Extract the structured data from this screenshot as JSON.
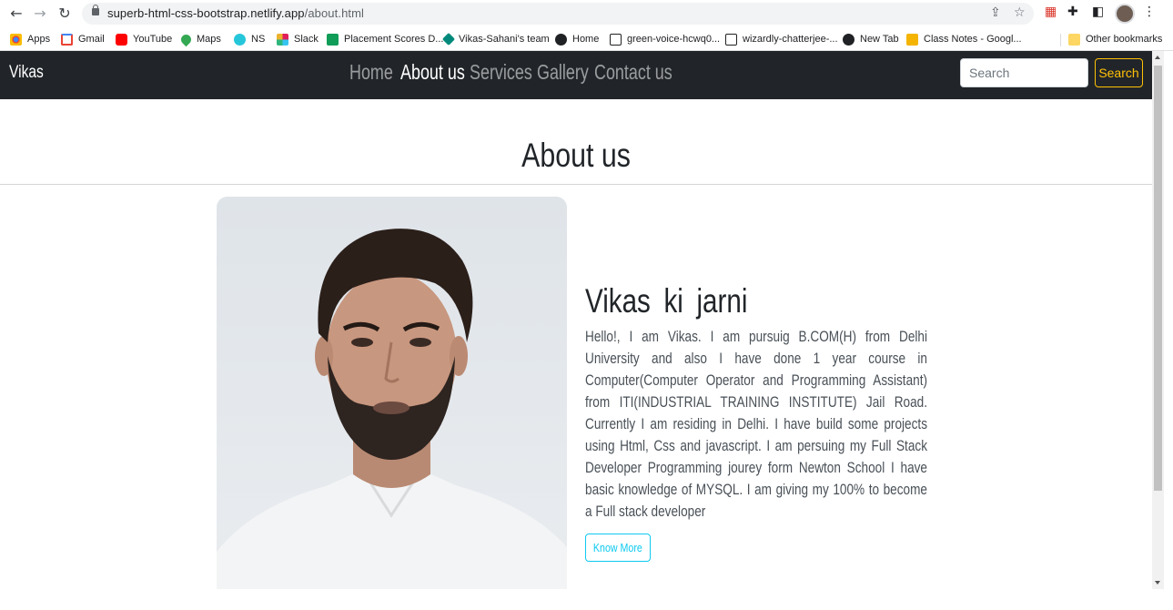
{
  "browser": {
    "url_host": "superb-html-css-bootstrap.netlify.app",
    "url_path": "/about.html",
    "bookmarks": [
      {
        "label": "Apps",
        "icon": "apps-grid-icon",
        "color": "#4285f4"
      },
      {
        "label": "Gmail",
        "icon": "gmail-icon",
        "color": "#ea4335"
      },
      {
        "label": "YouTube",
        "icon": "youtube-icon",
        "color": "#ff0000"
      },
      {
        "label": "Maps",
        "icon": "maps-pin-icon",
        "color": "#34a853"
      },
      {
        "label": "NS",
        "icon": "ns-icon",
        "color": "#26c6da"
      },
      {
        "label": "Slack",
        "icon": "slack-icon",
        "color": "#e01e5a"
      },
      {
        "label": "Placement Scores D...",
        "icon": "sheets-icon",
        "color": "#0f9d58"
      },
      {
        "label": "Vikas-Sahani's team",
        "icon": "team-diamond-icon",
        "color": "#00897b"
      },
      {
        "label": "Home",
        "icon": "globe-icon",
        "color": "#202124"
      },
      {
        "label": "green-voice-hcwq0...",
        "icon": "page-icon",
        "color": "#202124"
      },
      {
        "label": "wizardly-chatterjee-...",
        "icon": "page-icon",
        "color": "#202124"
      },
      {
        "label": "New Tab",
        "icon": "globe-icon",
        "color": "#202124"
      },
      {
        "label": "Class Notes - Googl...",
        "icon": "slides-icon",
        "color": "#f4b400"
      }
    ],
    "other_bookmarks": "Other bookmarks"
  },
  "navbar": {
    "brand": "Vikas",
    "links": [
      {
        "label": "Home",
        "active": false
      },
      {
        "label": "About us",
        "active": true
      },
      {
        "label": "Services",
        "active": false
      },
      {
        "label": "Gallery",
        "active": false
      },
      {
        "label": "Contact us",
        "active": false
      }
    ],
    "search_placeholder": "Search",
    "search_button": "Search"
  },
  "page": {
    "title": "About us",
    "heading": "Vikas ki jarni",
    "paragraph": "Hello!, I am Vikas. I am pursuig B.COM(H) from Delhi University and also I have done 1 year course in Computer(Computer Operator and Programming Assistant) from ITI(INDUSTRIAL TRAINING INSTITUTE) Jail Road. Currently I am residing in Delhi. I have build some projects using Html, Css and javascript. I am persuing my Full Stack Developer Programming jourey form Newton School I have basic knowledge of MYSQL. I am giving my 100% to become a Full stack developer",
    "button": "Know More"
  },
  "colors": {
    "navbar_bg": "#212529",
    "search_outline": "#ffc107",
    "know_more_outline": "#0dcaf0"
  }
}
